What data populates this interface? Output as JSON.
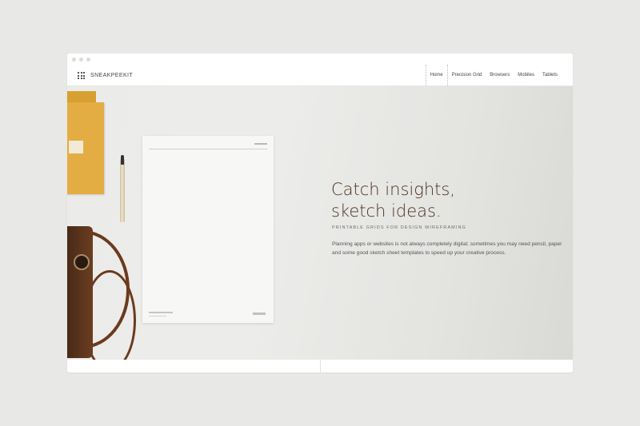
{
  "brand": {
    "name": "SNEAKPEEKIT",
    "logo_icon": "grid-dots-icon"
  },
  "nav": {
    "items": [
      {
        "label": "Home",
        "active": true
      },
      {
        "label": "Precision Grid",
        "active": false
      },
      {
        "label": "Browsers",
        "active": false
      },
      {
        "label": "Mobiles",
        "active": false
      },
      {
        "label": "Tablets",
        "active": false
      }
    ]
  },
  "hero": {
    "headline_line1": "Catch insights,",
    "headline_line2": "sketch ideas.",
    "subheading": "PRINTABLE GRIDS FOR DESIGN WIREFRAMING",
    "body": "Planning apps or websites is not always completely digital; sometimes you may need pencil, paper and some good sketch sheet templates to speed up your creative process."
  },
  "colors": {
    "background": "#e8e8e6",
    "headline": "#4a3520",
    "notebook": "#e4ad44",
    "leather": "#6b3a1e"
  }
}
